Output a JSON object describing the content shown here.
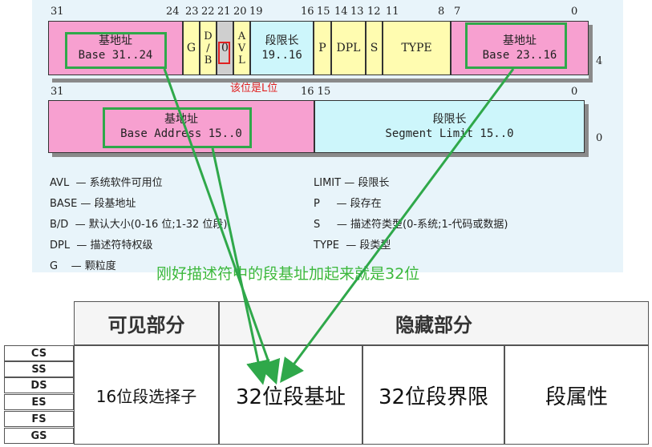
{
  "top_descriptor": {
    "bit_labels": [
      "31",
      "24",
      "23",
      "22",
      "21",
      "20",
      "19",
      "16",
      "15",
      "14",
      "13",
      "12",
      "11",
      "8",
      "7",
      "0"
    ],
    "row_number": "4",
    "cells": {
      "base_high_title": "基地址",
      "base_high_range": "Base 31..24",
      "g": "G",
      "db": [
        "D",
        "/",
        "B"
      ],
      "l": "0",
      "avl": [
        "A",
        "V",
        "L"
      ],
      "limit_title": "段限长",
      "limit_range": "19..16",
      "p": "P",
      "dpl": "DPL",
      "s": "S",
      "type": "TYPE",
      "base_mid_title": "基地址",
      "base_mid_range": "Base 23..16"
    },
    "annotation": "该位是L位"
  },
  "bottom_descriptor": {
    "bit_labels": [
      "31",
      "16 15",
      "0"
    ],
    "row_number": "0",
    "cells": {
      "base_low_title": "基地址",
      "base_low_range": "Base Address 15..0",
      "limit_low_title": "段限长",
      "limit_low_range": "Segment Limit 15..0"
    }
  },
  "legend_left": [
    "AVL  — 系统软件可用位",
    "BASE — 段基地址",
    "B/D  — 默认大小(0-16 位;1-32 位段)",
    "DPL  — 描述符特权级",
    "G    — 颗粒度"
  ],
  "legend_right": [
    "LIMIT — 段限长",
    "P     — 段存在",
    "S     — 描述符类型(0-系统;1-代码或数据)",
    "TYPE  — 段类型"
  ],
  "green_caption": "刚好描述符中的段基址加起来就是32位",
  "register_table": {
    "visible_header": "可见部分",
    "hidden_header": "隐藏部分",
    "registers": [
      "CS",
      "SS",
      "DS",
      "ES",
      "FS",
      "GS"
    ],
    "selector": "16位段选择子",
    "base": "32位段基址",
    "limit": "32位段界限",
    "attr": "段属性"
  },
  "colors": {
    "pink": "#f7a0d0",
    "yellow": "#fffcb0",
    "cyan": "#cdf6fb",
    "gray": "#cfcfcf",
    "green": "#2fa84a",
    "red": "#e02020"
  }
}
